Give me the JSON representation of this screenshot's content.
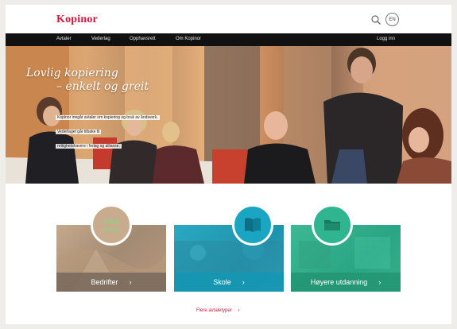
{
  "header": {
    "logo": "Kopinor",
    "language_button": "EN"
  },
  "nav": {
    "items": [
      {
        "label": "Avtaler"
      },
      {
        "label": "Vederlag"
      },
      {
        "label": "Opphavsrett"
      },
      {
        "label": "Om Kopinor"
      }
    ],
    "login_label": "Logg inn"
  },
  "hero": {
    "title_line1": "Lovlig kopiering",
    "title_line2": "– enkelt og greit",
    "text_line1": "Kopinor inngår avtaler om kopiering og bruk av åndsverk.",
    "text_line2": "Vederlaget går tilbake til",
    "text_line3": "rettighetshavere i forlag og allianse."
  },
  "cards": [
    {
      "label": "Bedrifter",
      "color": "#8a7868",
      "circle_color": "#c8a88a",
      "icon": "people-icon"
    },
    {
      "label": "Skole",
      "color": "#1fa3bd",
      "circle_color": "#1aa5c2",
      "icon": "book-icon"
    },
    {
      "label": "Høyere utdanning",
      "color": "#2aa684",
      "circle_color": "#2fb58f",
      "icon": "folder-icon"
    }
  ],
  "more_link": "Flere avtaletyper",
  "colors": {
    "brand_red": "#d4143c",
    "navbar": "#111111"
  }
}
